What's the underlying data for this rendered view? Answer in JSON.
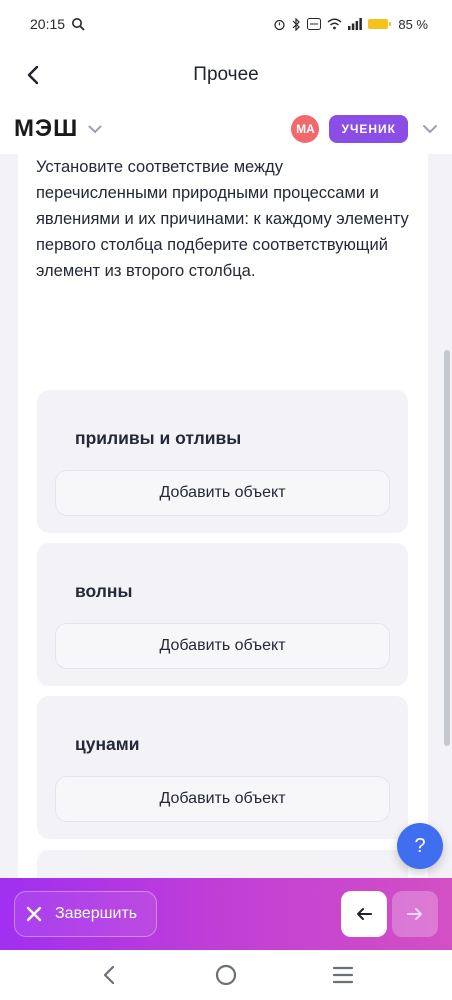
{
  "status_bar": {
    "time": "20:15",
    "battery": "85 %",
    "icons": [
      "search-icon",
      "alarm-icon",
      "bluetooth-icon",
      "volte-icon",
      "wifi-icon",
      "signal-icon",
      "battery-icon"
    ]
  },
  "header": {
    "title": "Прочее",
    "back_icon": "chevron-left-icon"
  },
  "brand": {
    "logo": "МЭШ",
    "avatar_initials": "МА",
    "role": "УЧЕНИК"
  },
  "question": {
    "text": "Установите соответствие между перечисленными природными процессами и явлениями и их причинами: к каждому элементу первого столбца подберите соответствующий элемент из второго столбца."
  },
  "items": [
    {
      "title": "приливы и отливы",
      "button": "Добавить объект"
    },
    {
      "title": "волны",
      "button": "Добавить объект"
    },
    {
      "title": "цунами",
      "button": "Добавить объект"
    }
  ],
  "help": {
    "label": "?"
  },
  "actions": {
    "finish_label": "Завершить",
    "prev_icon": "arrow-left-icon",
    "next_icon": "arrow-right-icon"
  },
  "colors": {
    "accent": "#8a4de6",
    "help": "#3f6ff0",
    "avatar": "#f2686b",
    "gradient_start": "#a02ff0",
    "gradient_end": "#d24fc4"
  }
}
